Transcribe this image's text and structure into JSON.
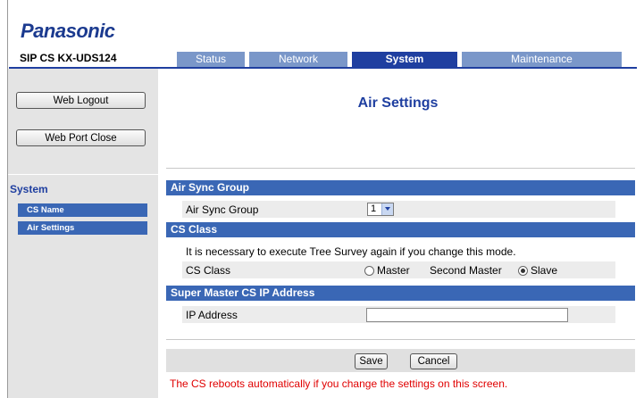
{
  "brand": "Panasonic",
  "model": "SIP CS KX-UDS124",
  "tabs": [
    "Status",
    "Network",
    "System",
    "Maintenance"
  ],
  "active_tab": "System",
  "sidebar": {
    "buttons": [
      "Web Logout",
      "Web Port Close"
    ],
    "section": "System",
    "items": [
      "CS Name",
      "Air Settings"
    ]
  },
  "page_title": "Air Settings",
  "air_sync": {
    "header": "Air Sync Group",
    "label": "Air Sync Group",
    "value": "1"
  },
  "cs_class": {
    "header": "CS Class",
    "note": "It is necessary to execute Tree Survey again if you change this mode.",
    "label": "CS Class",
    "options": [
      "Master",
      "Second Master",
      "Slave"
    ],
    "selected": "Slave"
  },
  "super_master": {
    "header": "Super Master CS IP Address",
    "label": "IP Address",
    "value": ""
  },
  "actions": {
    "save": "Save",
    "cancel": "Cancel"
  },
  "warning": "The CS reboots automatically if you change the settings on this screen.",
  "colors": {
    "brand": "#1b3a8f",
    "tab_inactive": "#7a97c9",
    "tab_active": "#1f3fa0",
    "section_header": "#3a67b5",
    "sidebar_bg": "#e4e4e4",
    "warning": "#e00000"
  }
}
